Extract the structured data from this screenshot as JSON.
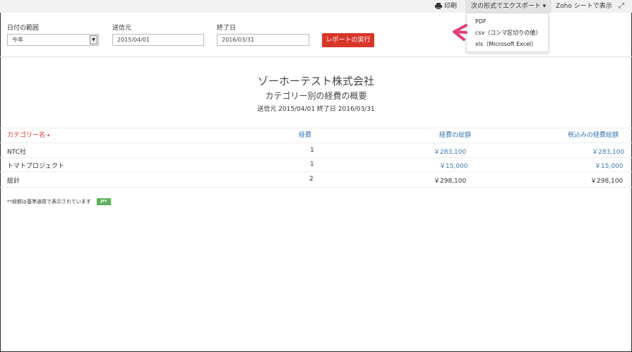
{
  "toolbar": {
    "print_label": "印刷",
    "export_label": "次の形式でエクスポート",
    "zoho_sheet_label": "Zoho シートで表示"
  },
  "export_menu": {
    "items": [
      "PDF",
      "csv（コンマ区切りの値）",
      "xls（Microsoft Excel）"
    ]
  },
  "filters": {
    "date_range_label": "日付の範囲",
    "date_range_value": "今年",
    "from_label": "送信元",
    "from_value": "2015/04/01",
    "to_label": "終了日",
    "to_value": "2016/03/31",
    "run_button": "レポートの実行"
  },
  "report": {
    "company": "ゾーホーテスト株式会社",
    "title": "カテゴリー別の経費の概要",
    "period": "送信元 2015/04/01 終了日 2016/03/31"
  },
  "table": {
    "headers": [
      "カテゴリー名",
      "経費",
      "経費の総額",
      "税込みの経費総額"
    ],
    "rows": [
      [
        "NTC社",
        "1",
        "￥283,100",
        "￥283,100"
      ],
      [
        "トマトプロジェクト",
        "1",
        "￥15,000",
        "￥15,000"
      ],
      [
        "総計",
        "2",
        "￥298,100",
        "￥298,100"
      ]
    ]
  },
  "footnote": "**総額は基準通貨で表示されています",
  "currency_badge": "JPY",
  "colors": {
    "accent_red": "#d9362a",
    "link_blue": "#3a78b5",
    "arrow_pink": "#e0407a",
    "badge_green": "#59b25a"
  }
}
